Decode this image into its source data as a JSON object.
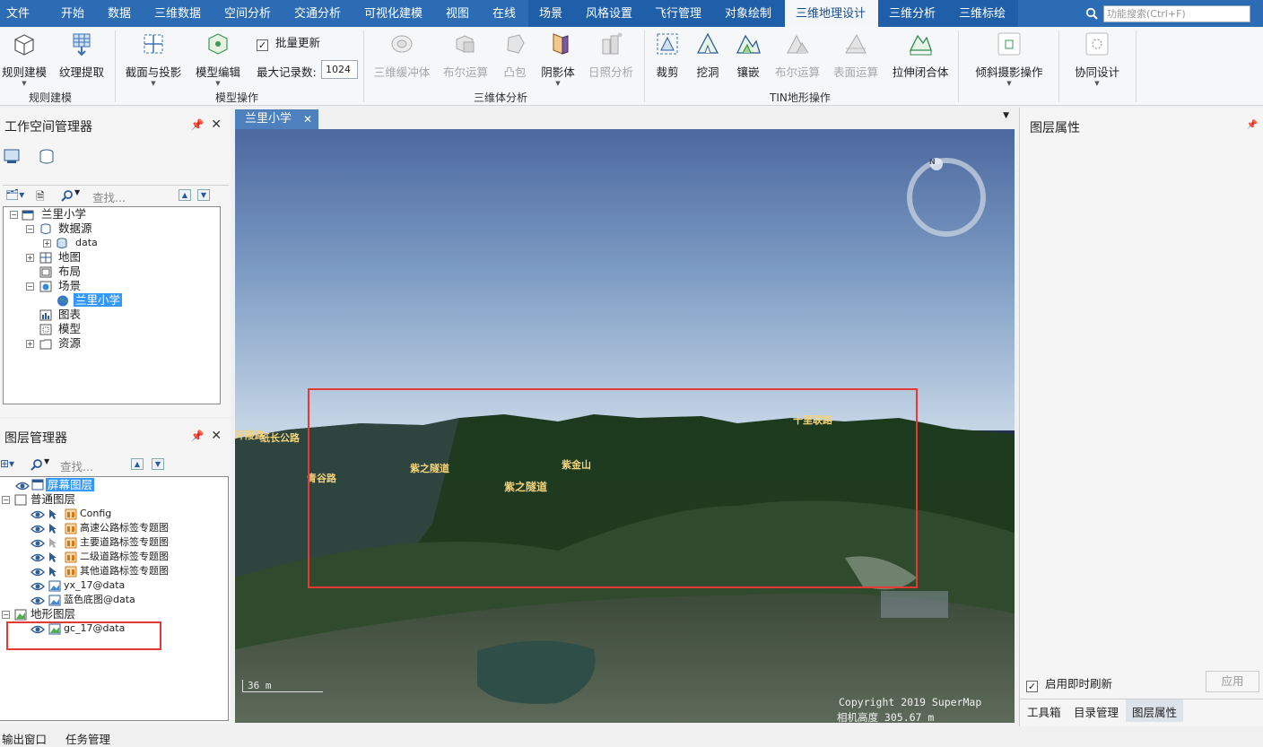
{
  "menu": {
    "tabs": [
      "文件",
      "开始",
      "数据",
      "三维数据",
      "空间分析",
      "交通分析",
      "可视化建模",
      "视图",
      "在线",
      "场景",
      "风格设置",
      "飞行管理",
      "对象绘制",
      "三维地理设计",
      "三维分析",
      "三维标绘"
    ],
    "active": "三维地理设计",
    "search_placeholder": "功能搜索(Ctrl+F)"
  },
  "ribbon": {
    "groups": {
      "rule": "规则建模",
      "model": "模型操作",
      "solid": "三维体分析",
      "tin": "TIN地形操作"
    },
    "buttons": {
      "rule_model": "规则建模",
      "texture": "纹理提取",
      "section": "截面与投影",
      "model_edit": "模型编辑",
      "batch_update": "批量更新",
      "max_records_label": "最大记录数:",
      "max_records_value": "1024",
      "buffer3d": "三维缓冲体",
      "boolean": "布尔运算",
      "convex": "凸包",
      "shadow": "阴影体",
      "sunlight": "日照分析",
      "clip": "裁剪",
      "dig": "挖洞",
      "inlay": "镶嵌",
      "tin_boolean": "布尔运算",
      "surface": "表面运算",
      "extrude": "拉伸闭合体",
      "oblique": "倾斜摄影操作",
      "collab": "协同设计"
    }
  },
  "workspace": {
    "title": "工作空间管理器",
    "find": "查找...",
    "nodes": {
      "root": "兰里小学",
      "datasource": "数据源",
      "data": "data",
      "maps": "地图",
      "layouts": "布局",
      "scenes": "场景",
      "scene1": "兰里小学",
      "charts": "图表",
      "models": "模型",
      "resources": "资源"
    }
  },
  "layers": {
    "title": "图层管理器",
    "find": "查找...",
    "screen": "屏幕图层",
    "normal": "普通图层",
    "items": [
      "Config",
      "高速公路标签专题图",
      "主要道路标签专题图",
      "二级道路标签专题图",
      "其他道路标签专题图",
      "yx_17@data",
      "蓝色底图@data"
    ],
    "terrain": "地形图层",
    "terrain_item": "gc_17@data"
  },
  "scene": {
    "tab": "兰里小学",
    "labels": [
      "紫之隧道",
      "紫之隧道",
      "紫金山",
      "十里联路",
      "青谷路",
      "环陵路",
      "纸长公路"
    ],
    "scale": "36 m",
    "copyright": "Copyright 2019 SuperMap",
    "camera": "相机高度 305.67 m"
  },
  "properties": {
    "title": "图层属性",
    "refresh": "启用即时刷新",
    "apply": "应用",
    "tabs": [
      "工具箱",
      "目录管理",
      "图层属性"
    ]
  },
  "statusbar": [
    "输出窗口",
    "任务管理"
  ]
}
